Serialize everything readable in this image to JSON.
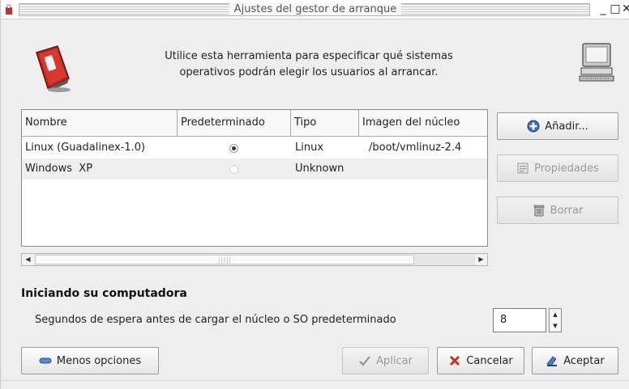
{
  "window": {
    "title": "Ajustes del gestor de arranque",
    "controls": {
      "minimize": "_",
      "maximize": "□",
      "close": "✕"
    }
  },
  "header": {
    "description_line1": "Utilice esta herramienta para especificar qué sistemas",
    "description_line2": "operativos podrán elegir los usuarios al arrancar.",
    "left_icon": "power-switch-icon",
    "right_icon": "computer-icon"
  },
  "table": {
    "columns": [
      "Nombre",
      "Predeterminado",
      "Tipo",
      "Imagen del núcleo"
    ],
    "rows": [
      {
        "name": "Linux (Guadalinex-1.0)",
        "default": true,
        "type": "Linux",
        "kernel": "/boot/vmlinuz-2.4"
      },
      {
        "name": "Windows  XP",
        "default": false,
        "type": "Unknown",
        "kernel": ""
      }
    ]
  },
  "side_buttons": {
    "add": "Añadir...",
    "properties": "Propiedades",
    "delete": "Borrar"
  },
  "startup": {
    "section_title": "Iniciando su computadora",
    "wait_label": "Segundos de espera antes de cargar el núcleo o SO predeterminado",
    "wait_value": "8"
  },
  "footer": {
    "less_options": "Menos opciones",
    "apply": "Aplicar",
    "cancel": "Cancelar",
    "accept": "Aceptar"
  },
  "colors": {
    "accent_red": "#c8302a",
    "disabled_text": "#9a9a9a"
  }
}
